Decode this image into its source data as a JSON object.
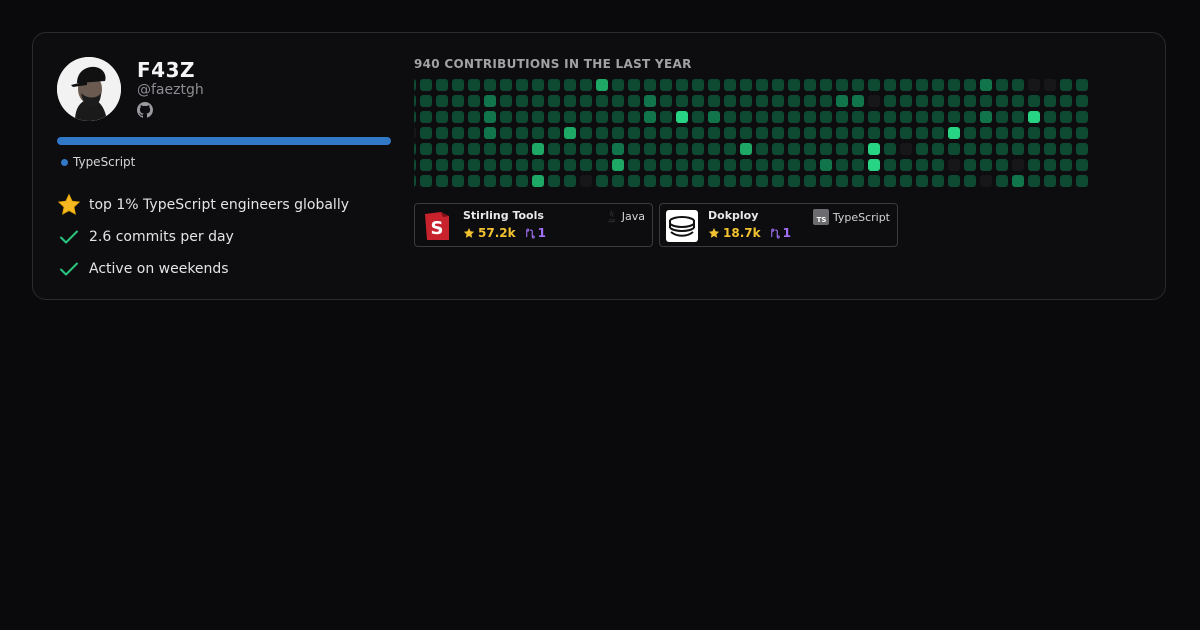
{
  "profile": {
    "name": "F43Z",
    "handle": "@faeztgh"
  },
  "language": {
    "name": "TypeScript",
    "color": "#3178c6",
    "share": 1.0
  },
  "stats": [
    {
      "icon": "star-icon",
      "text": "top 1% TypeScript engineers globally"
    },
    {
      "icon": "check-icon",
      "text": "2.6 commits per day"
    },
    {
      "icon": "check-icon",
      "text": "Active on weekends"
    }
  ],
  "contributions": {
    "title": "940 CONTRIBUTIONS IN THE LAST YEAR",
    "colors": [
      "#17171a",
      "#0e4a32",
      "#11744a",
      "#1ea866",
      "#27d483"
    ],
    "weeks": [
      [
        1,
        1,
        1,
        0,
        1,
        1,
        1
      ],
      [
        1,
        1,
        1,
        1,
        1,
        1,
        1
      ],
      [
        1,
        1,
        1,
        1,
        1,
        1,
        1
      ],
      [
        1,
        1,
        1,
        1,
        1,
        1,
        1
      ],
      [
        1,
        1,
        1,
        1,
        1,
        1,
        1
      ],
      [
        1,
        2,
        2,
        2,
        1,
        1,
        1
      ],
      [
        1,
        1,
        1,
        1,
        1,
        1,
        1
      ],
      [
        1,
        1,
        1,
        1,
        1,
        1,
        1
      ],
      [
        1,
        1,
        1,
        1,
        3,
        1,
        3
      ],
      [
        1,
        1,
        1,
        1,
        1,
        1,
        1
      ],
      [
        1,
        1,
        1,
        3,
        1,
        1,
        1
      ],
      [
        1,
        1,
        1,
        1,
        1,
        1,
        0
      ],
      [
        3,
        1,
        1,
        1,
        1,
        1,
        1
      ],
      [
        1,
        1,
        1,
        1,
        2,
        3,
        1
      ],
      [
        1,
        1,
        1,
        1,
        1,
        1,
        1
      ],
      [
        1,
        2,
        2,
        1,
        1,
        1,
        1
      ],
      [
        1,
        1,
        1,
        1,
        1,
        1,
        1
      ],
      [
        1,
        1,
        4,
        1,
        1,
        1,
        1
      ],
      [
        1,
        1,
        1,
        1,
        1,
        1,
        1
      ],
      [
        1,
        1,
        2,
        1,
        1,
        1,
        1
      ],
      [
        1,
        1,
        1,
        1,
        1,
        1,
        1
      ],
      [
        1,
        1,
        1,
        1,
        3,
        1,
        1
      ],
      [
        1,
        1,
        1,
        1,
        1,
        1,
        1
      ],
      [
        1,
        1,
        1,
        1,
        1,
        1,
        1
      ],
      [
        1,
        1,
        1,
        1,
        1,
        1,
        1
      ],
      [
        1,
        1,
        1,
        1,
        1,
        1,
        1
      ],
      [
        1,
        1,
        1,
        1,
        1,
        2,
        1
      ],
      [
        1,
        2,
        1,
        1,
        1,
        1,
        1
      ],
      [
        1,
        2,
        1,
        1,
        1,
        1,
        1
      ],
      [
        1,
        0,
        1,
        1,
        4,
        4,
        1
      ],
      [
        1,
        1,
        1,
        1,
        1,
        1,
        1
      ],
      [
        1,
        1,
        1,
        1,
        0,
        1,
        1
      ],
      [
        1,
        1,
        1,
        1,
        1,
        1,
        1
      ],
      [
        1,
        1,
        1,
        1,
        1,
        1,
        1
      ],
      [
        1,
        1,
        1,
        4,
        1,
        0,
        1
      ],
      [
        1,
        1,
        1,
        1,
        1,
        1,
        1
      ],
      [
        2,
        1,
        2,
        1,
        1,
        1,
        0
      ],
      [
        1,
        1,
        1,
        1,
        1,
        1,
        1
      ],
      [
        1,
        1,
        1,
        1,
        1,
        0,
        2
      ],
      [
        0,
        1,
        4,
        1,
        1,
        1,
        1
      ],
      [
        0,
        1,
        1,
        1,
        1,
        1,
        1
      ],
      [
        1,
        1,
        1,
        1,
        1,
        1,
        1
      ],
      [
        1,
        1,
        1,
        1,
        1,
        1,
        1
      ]
    ]
  },
  "repos": [
    {
      "name": "Stirling Tools",
      "stars": "57.2k",
      "prs": "1",
      "language": "Java",
      "logo": "stirling-logo"
    },
    {
      "name": "Dokploy",
      "stars": "18.7k",
      "prs": "1",
      "language": "TypeScript",
      "logo": "dokploy-logo"
    }
  ]
}
